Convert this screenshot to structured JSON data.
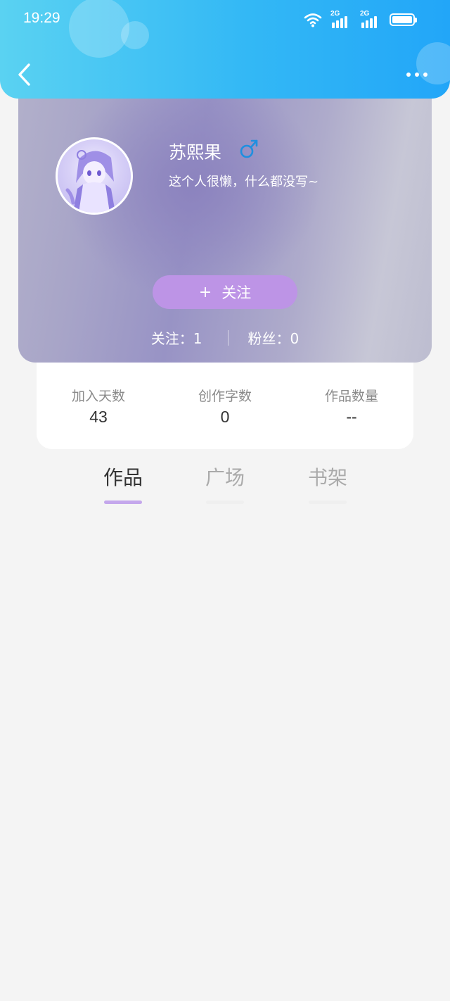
{
  "status_bar": {
    "time": "19:29",
    "network_1": "2G",
    "network_2": "2G"
  },
  "header": {
    "back_icon": "chevron-left-icon",
    "more_icon": "more-dots-icon"
  },
  "profile": {
    "name": "苏熙果",
    "gender_icon": "male-icon",
    "bio": "这个人很懒，什么都没写~",
    "follow_button_label": "关注",
    "follow_button_plus": "+",
    "following_text": "关注：1",
    "followers_text": "粉丝：0"
  },
  "stats": [
    {
      "label": "加入天数",
      "value": "43"
    },
    {
      "label": "创作字数",
      "value": "0"
    },
    {
      "label": "作品数量",
      "value": "--"
    }
  ],
  "tabs": [
    {
      "label": "作品",
      "active": true
    },
    {
      "label": "广场",
      "active": false
    },
    {
      "label": "书架",
      "active": false
    }
  ],
  "colors": {
    "header_gradient_start": "#5ad2f2",
    "header_gradient_end": "#22a6f8",
    "follow_button": "#bd94e6",
    "tab_indicator_active": "#c4a7ec",
    "gender_icon": "#1f8fe0"
  }
}
